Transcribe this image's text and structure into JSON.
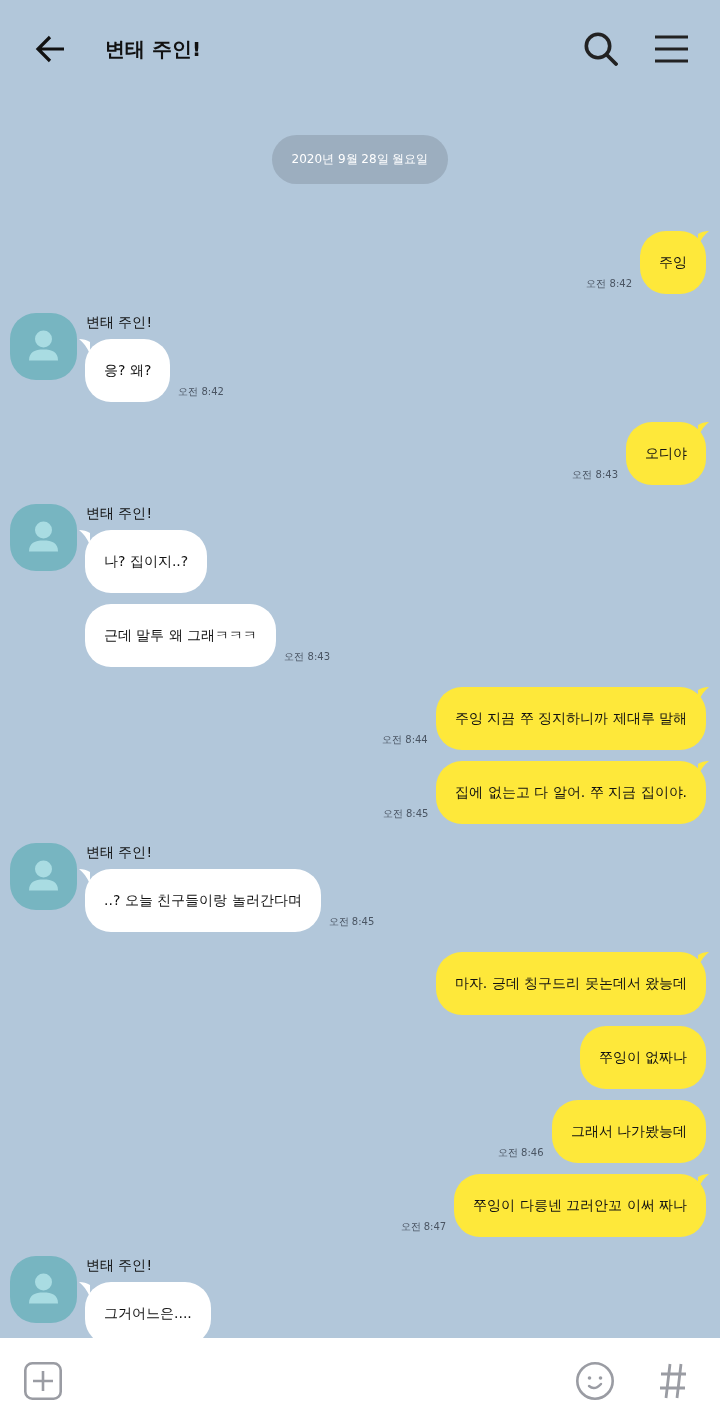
{
  "header": {
    "title": "변태 주인!"
  },
  "date_divider": "2020년 9월 28일 월요일",
  "groups": [
    {
      "kind": "sent",
      "messages": [
        "주잉"
      ],
      "time": "오전 8:42"
    },
    {
      "kind": "received",
      "name": "변태 주인!",
      "messages": [
        "응? 왜?"
      ],
      "time": "오전 8:42"
    },
    {
      "kind": "sent",
      "messages": [
        "오디야"
      ],
      "time": "오전 8:43"
    },
    {
      "kind": "received",
      "name": "변태 주인!",
      "messages": [
        "나? 집이지..?",
        "근데 말투 왜 그래ㅋㅋㅋ"
      ],
      "time": "오전 8:43"
    },
    {
      "kind": "sent",
      "messages": [
        "주잉 지끔 쭈 징지하니까 제대루 말해"
      ],
      "time": "오전 8:44"
    },
    {
      "kind": "sent",
      "messages": [
        "집에 없는고 다 알어. 쭈 지금 집이야."
      ],
      "time": "오전 8:45"
    },
    {
      "kind": "received",
      "name": "변태 주인!",
      "messages": [
        "..? 오늘 친구들이랑 놀러간다며"
      ],
      "time": "오전 8:45"
    },
    {
      "kind": "sent",
      "messages": [
        "마자. 긍데 칭구드리 못논데서 왔능데",
        "쭈잉이 없짜나",
        "그래서 나가봤능데"
      ],
      "time": "오전 8:46"
    },
    {
      "kind": "sent",
      "messages": [
        "쭈잉이 다릉넨 끄러안꼬 이써 짜나"
      ],
      "time": "오전 8:47"
    },
    {
      "kind": "received",
      "name": "변태 주인!",
      "messages": [
        "그거어느은...."
      ]
    }
  ]
}
